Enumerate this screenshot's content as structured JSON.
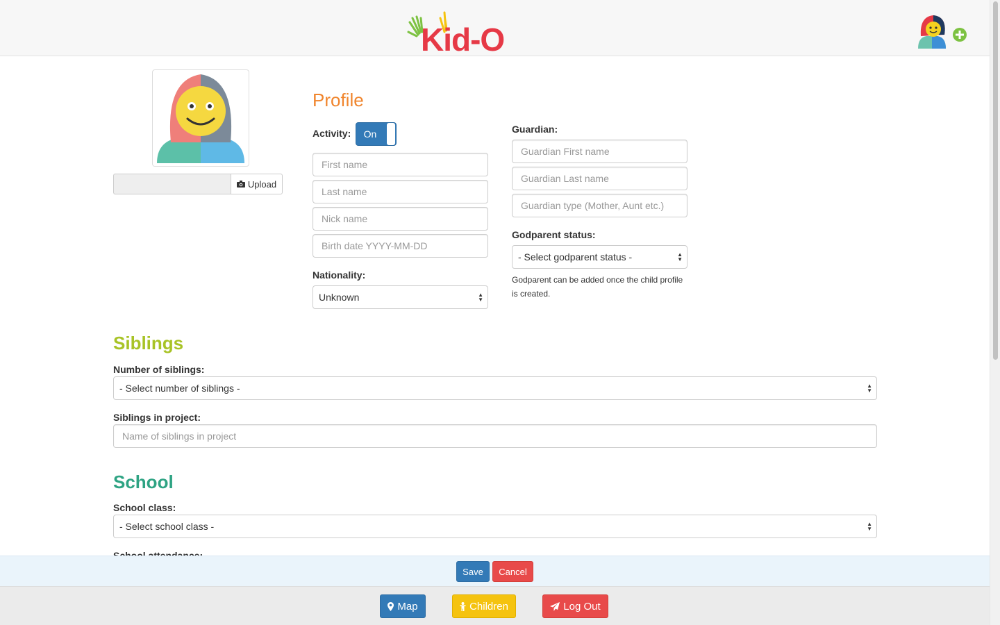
{
  "header": {
    "logo_text": "Kid-O"
  },
  "profile": {
    "heading": "Profile",
    "activity_label": "Activity:",
    "activity_toggle": "On",
    "first_name_placeholder": "First name",
    "last_name_placeholder": "Last name",
    "nick_name_placeholder": "Nick name",
    "birth_date_placeholder": "Birth date YYYY-MM-DD",
    "nationality_label": "Nationality:",
    "nationality_value": "Unknown",
    "upload_label": "Upload"
  },
  "guardian": {
    "label": "Guardian:",
    "first_name_placeholder": "Guardian First name",
    "last_name_placeholder": "Guardian Last name",
    "type_placeholder": "Guardian type (Mother, Aunt etc.)",
    "godparent_label": "Godparent status:",
    "godparent_value": "- Select godparent status -",
    "godparent_note": "Godparent can be added once the child profile is created."
  },
  "siblings": {
    "heading": "Siblings",
    "number_label": "Number of siblings:",
    "number_value": "- Select number of siblings -",
    "in_project_label": "Siblings in project:",
    "in_project_placeholder": "Name of siblings in project"
  },
  "school": {
    "heading": "School",
    "class_label": "School class:",
    "class_value": "- Select school class -",
    "attendance_label": "School attendance:"
  },
  "actions": {
    "save": "Save",
    "cancel": "Cancel"
  },
  "footer_nav": {
    "map": "Map",
    "children": "Children",
    "logout": "Log Out"
  },
  "colors": {
    "primary": "#337ab7",
    "danger": "#e84a4a",
    "warning": "#f5c30f",
    "profile_heading": "#f0852d",
    "siblings_heading": "#a8c326",
    "school_heading": "#2ea383"
  },
  "icons": {
    "upload": "camera-icon",
    "map": "map-marker-icon",
    "children": "child-icon",
    "logout": "paper-plane-icon",
    "add_child": "add-child-icon"
  }
}
